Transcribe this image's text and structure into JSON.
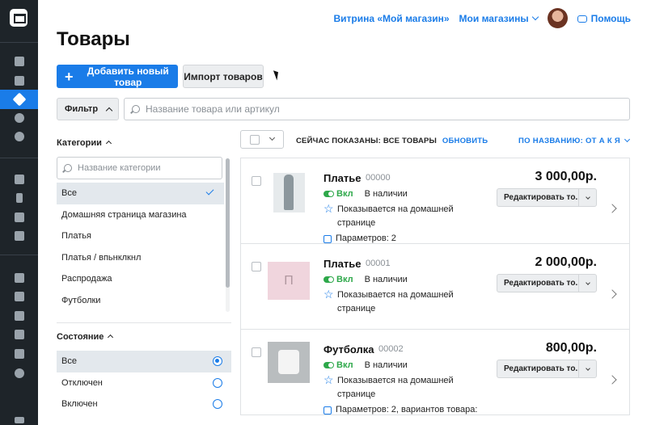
{
  "header": {
    "storefront_link": "Витрина «Мой магазин»",
    "my_stores": "Мои магазины",
    "help": "Помощь"
  },
  "page_title": "Товары",
  "actions": {
    "add_product": "Добавить новый товар",
    "import_products": "Импорт товаров"
  },
  "filter": {
    "button_label": "Фильтр",
    "search_placeholder": "Название товара или артикул"
  },
  "categories": {
    "title": "Категории",
    "search_placeholder": "Название категории",
    "items": [
      "Все",
      "Домашняя страница магазина",
      "Платья",
      "Платья / впьнклкнл",
      "Распродажа",
      "Футболки"
    ],
    "selected": "Все"
  },
  "states": {
    "title": "Состояние",
    "items": [
      "Все",
      "Отключен",
      "Включен"
    ],
    "selected": "Все"
  },
  "list_toolbar": {
    "shown_label": "СЕЙЧАС ПОКАЗАНЫ: ВСЕ ТОВАРЫ",
    "refresh": "ОБНОВИТЬ",
    "sort": "ПО НАЗВАНИЮ: ОТ А К Я"
  },
  "products": [
    {
      "name": "Платье",
      "sku": "00000",
      "price": "3 000,00р.",
      "enabled_label": "Вкл",
      "stock": "В наличии",
      "home_note": "Показывается на домашней странице",
      "params": "Параметров: 2",
      "edit_label": "Редактировать то...",
      "image": "dress-photo"
    },
    {
      "name": "Платье",
      "sku": "00001",
      "price": "2 000,00р.",
      "enabled_label": "Вкл",
      "stock": "В наличии",
      "home_note": "Показывается на домашней странице",
      "edit_label": "Редактировать то...",
      "image_letter": "П"
    },
    {
      "name": "Футболка",
      "sku": "00002",
      "price": "800,00р.",
      "enabled_label": "Вкл",
      "stock": "В наличии",
      "home_note": "Показывается на домашней странице",
      "params": "Параметров: 2, вариантов товара:",
      "edit_label": "Редактировать то...",
      "image": "tshirt-photo"
    }
  ],
  "colors": {
    "accent": "#1a7ce8",
    "sidebar": "#1e2429",
    "enabled": "#2ea84a"
  }
}
